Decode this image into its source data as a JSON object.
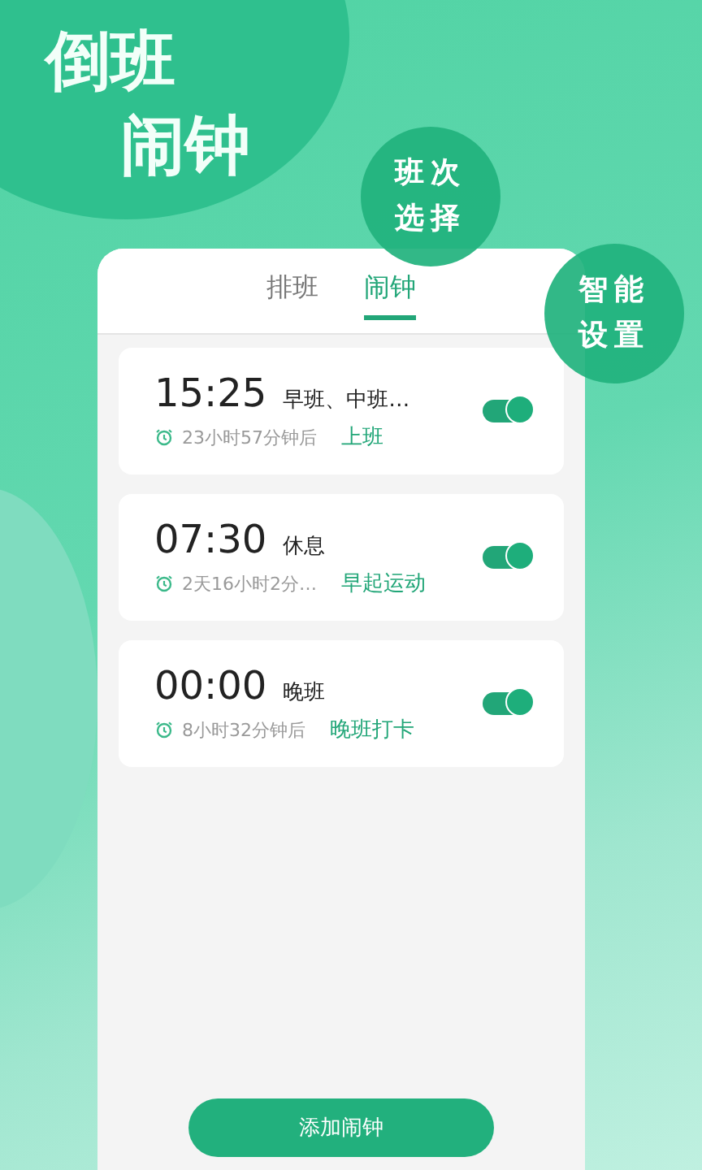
{
  "title_lines": [
    "倒班",
    "闹钟"
  ],
  "badges": [
    {
      "lines": [
        "班次",
        "选择"
      ]
    },
    {
      "lines": [
        "智能",
        "设置"
      ]
    }
  ],
  "tabs": [
    {
      "label": "排班",
      "selected": false
    },
    {
      "label": "闹钟",
      "selected": true
    }
  ],
  "alarms": [
    {
      "time": "15:25",
      "shift": "早班、中班…",
      "countdown": "23小时57分钟后",
      "label": "上班",
      "on": true
    },
    {
      "time": "07:30",
      "shift": "休息",
      "countdown": "2天16小时2分…",
      "label": "早起运动",
      "on": true
    },
    {
      "time": "00:00",
      "shift": "晚班",
      "countdown": "8小时32分钟后",
      "label": "晚班打卡",
      "on": true
    }
  ],
  "add_button": "添加闹钟"
}
